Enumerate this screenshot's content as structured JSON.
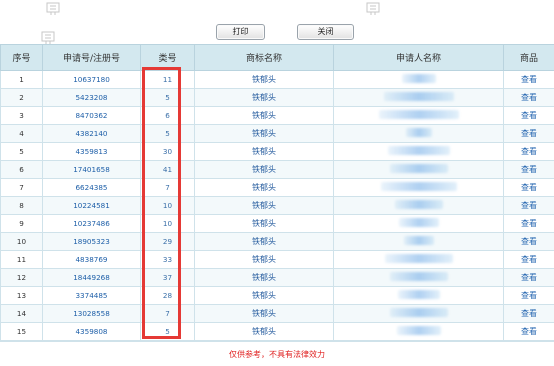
{
  "toolbar": {
    "print_label": "打印",
    "close_label": "关闭"
  },
  "table": {
    "headers": [
      "序号",
      "申请号/注册号",
      "类号",
      "商标名称",
      "申请人名称",
      "商品"
    ],
    "rows": [
      {
        "no": "1",
        "reg": "10637180",
        "cls": "11",
        "mark": "铁郁头",
        "view": "查看"
      },
      {
        "no": "2",
        "reg": "5423208",
        "cls": "5",
        "mark": "铁郁头",
        "view": "查看"
      },
      {
        "no": "3",
        "reg": "8470362",
        "cls": "6",
        "mark": "铁郁头",
        "view": "查看"
      },
      {
        "no": "4",
        "reg": "4382140",
        "cls": "5",
        "mark": "铁郁头",
        "view": "查看"
      },
      {
        "no": "5",
        "reg": "4359813",
        "cls": "30",
        "mark": "铁郁头",
        "view": "查看"
      },
      {
        "no": "6",
        "reg": "17401658",
        "cls": "41",
        "mark": "铁郁头",
        "view": "查看"
      },
      {
        "no": "7",
        "reg": "6624385",
        "cls": "7",
        "mark": "铁郁头",
        "view": "查看"
      },
      {
        "no": "8",
        "reg": "10224581",
        "cls": "10",
        "mark": "铁郁头",
        "view": "查看"
      },
      {
        "no": "9",
        "reg": "10237486",
        "cls": "10",
        "mark": "铁郁头",
        "view": "查看"
      },
      {
        "no": "10",
        "reg": "18905323",
        "cls": "29",
        "mark": "铁郁头",
        "view": "查看"
      },
      {
        "no": "11",
        "reg": "4838769",
        "cls": "33",
        "mark": "铁郁头",
        "view": "查看"
      },
      {
        "no": "12",
        "reg": "18449268",
        "cls": "37",
        "mark": "铁郁头",
        "view": "查看"
      },
      {
        "no": "13",
        "reg": "3374485",
        "cls": "28",
        "mark": "铁郁头",
        "view": "查看"
      },
      {
        "no": "14",
        "reg": "13028558",
        "cls": "7",
        "mark": "铁郁头",
        "view": "查看"
      },
      {
        "no": "15",
        "reg": "4359808",
        "cls": "5",
        "mark": "铁郁头",
        "view": "查看"
      }
    ]
  },
  "footer": {
    "disclaimer": "仅供参考，不具有法律效力"
  },
  "colors": {
    "header_bg": "#d3e8ef",
    "highlight_box": "#e53935",
    "link": "#2566b0"
  }
}
